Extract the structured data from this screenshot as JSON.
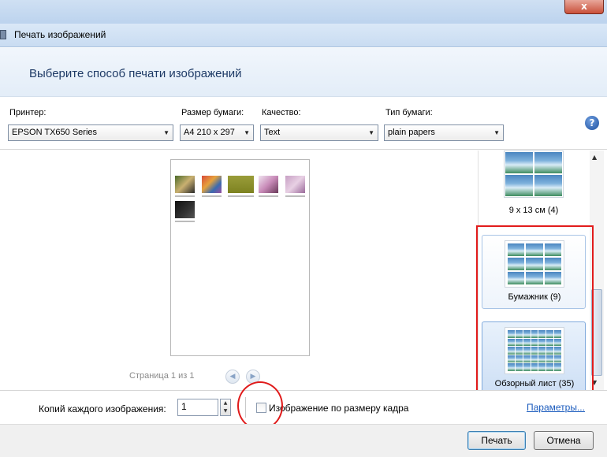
{
  "window": {
    "title": "Печать изображений",
    "close_label": "x"
  },
  "header": {
    "text": "Выберите способ печати изображений"
  },
  "controls": {
    "printer_label": "Принтер:",
    "printer_value": "EPSON TX650 Series",
    "paper_size_label": "Размер бумаги:",
    "paper_size_value": "A4 210 x 297",
    "quality_label": "Качество:",
    "quality_value": "Text",
    "paper_type_label": "Тип бумаги:",
    "paper_type_value": "plain papers",
    "help_label": "?"
  },
  "preview": {
    "page_info": "Страница 1 из 1"
  },
  "layouts": [
    {
      "label": "9 x 13 см (4)"
    },
    {
      "label": "Бумажник (9)"
    },
    {
      "label": "Обзорный лист (35)"
    }
  ],
  "bottom": {
    "copies_label": "Копий каждого изображения:",
    "copies_value": "1",
    "fit_label": "Изображение по размеру кадра",
    "params_link": "Параметры..."
  },
  "footer": {
    "print_label": "Печать",
    "cancel_label": "Отмена"
  },
  "colors": {
    "highlight_red": "#e21c1c",
    "link_blue": "#1a5bbd"
  }
}
